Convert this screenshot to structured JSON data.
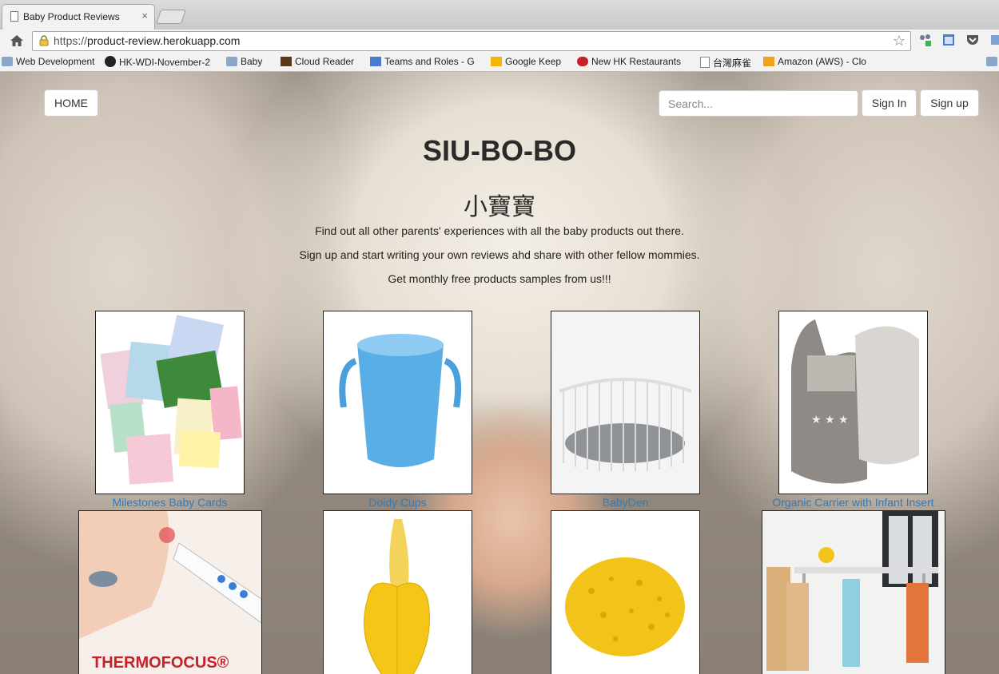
{
  "browser": {
    "tab_title": "Baby Product Reviews",
    "tab_close": "×",
    "url_scheme": "https://",
    "url_host": "product-review.herokuapp.com",
    "bookmarks": [
      {
        "label": "Web Development",
        "icon": "folder-icon"
      },
      {
        "label": "HK-WDI-November-2",
        "icon": "github-icon"
      },
      {
        "label": "Baby",
        "icon": "folder-icon"
      },
      {
        "label": "Cloud Reader",
        "icon": "kindle-icon"
      },
      {
        "label": "Teams and Roles - G",
        "icon": "google-icon"
      },
      {
        "label": "Google Keep",
        "icon": "keep-icon"
      },
      {
        "label": "New HK Restaurants",
        "icon": "openrice-icon"
      },
      {
        "label": "台灣麻雀",
        "icon": "page-icon"
      },
      {
        "label": "Amazon (AWS) - Clo",
        "icon": "aws-icon"
      }
    ]
  },
  "nav": {
    "home": "HOME",
    "search_placeholder": "Search...",
    "sign_in": "Sign In",
    "sign_up": "Sign up"
  },
  "hero": {
    "title": "SIU-BO-BO",
    "subtitle": "小寶寶",
    "lines": [
      "Find out all other parents' experiences with all the baby products out there.",
      "Sign up and start writing your own reviews ahd share with other fellow mommies.",
      "Get monthly free products samples from us!!!"
    ]
  },
  "products": [
    {
      "name": "Milestones Baby Cards"
    },
    {
      "name": "Doidy Cups"
    },
    {
      "name": "BabyDen"
    },
    {
      "name": "Organic Carrier with Infant Insert"
    },
    {
      "name": "",
      "image_text": "THERMOFOCUS®"
    },
    {
      "name": ""
    },
    {
      "name": ""
    },
    {
      "name": ""
    }
  ],
  "colors": {
    "link": "#337ab7",
    "thermofocus_red": "#c8202a"
  }
}
